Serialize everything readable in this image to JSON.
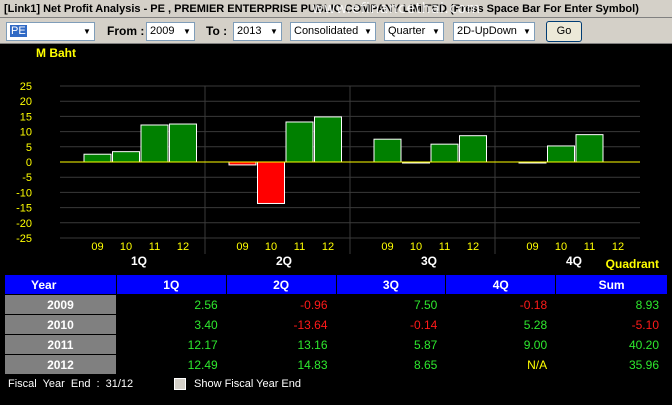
{
  "window": {
    "title": "[Link1] Net Profit Analysis - PE , PREMIER ENTERPRISE PUBLIC COMPANY LIMITED      (Press Space Bar For Enter Symbol)",
    "watermark": "www.efinancethai.com"
  },
  "toolbar": {
    "symbol_value": "PE",
    "from_label": "From :",
    "from_value": "2009",
    "to_label": "To :",
    "to_value": "2013",
    "statement_value": "Consolidated",
    "period_value": "Quarter",
    "view_value": "2D-UpDown",
    "go_label": "Go"
  },
  "chart_data": {
    "type": "bar",
    "ylabel": "M Baht",
    "xlabel": "Quadrant",
    "ylim": [
      -25,
      25
    ],
    "yticks": [
      25,
      20,
      15,
      10,
      5,
      0,
      -5,
      -10,
      -15,
      -20,
      -25
    ],
    "groups": [
      "1Q",
      "2Q",
      "3Q",
      "4Q"
    ],
    "years": [
      "09",
      "10",
      "11",
      "12"
    ],
    "values": [
      [
        2.56,
        3.4,
        12.17,
        12.49
      ],
      [
        -0.96,
        -13.64,
        13.16,
        14.83
      ],
      [
        7.5,
        -0.14,
        5.87,
        8.65
      ],
      [
        -0.18,
        5.28,
        9.0,
        null
      ]
    ],
    "colors": {
      "positive": "#008000",
      "negative": "#ff0000",
      "zero_line": "#ffff00",
      "tick_label": "#ffff00",
      "grid": "#3a3a3a"
    },
    "grid": true
  },
  "table": {
    "headers": [
      "Year",
      "1Q",
      "2Q",
      "3Q",
      "4Q",
      "Sum"
    ],
    "rows": [
      {
        "year": "2009",
        "q1": "2.56",
        "q2": "-0.96",
        "q3": "7.50",
        "q4": "-0.18",
        "sum": "8.93"
      },
      {
        "year": "2010",
        "q1": "3.40",
        "q2": "-13.64",
        "q3": "-0.14",
        "q4": "5.28",
        "sum": "-5.10"
      },
      {
        "year": "2011",
        "q1": "12.17",
        "q2": "13.16",
        "q3": "5.87",
        "q4": "9.00",
        "sum": "40.20"
      },
      {
        "year": "2012",
        "q1": "12.49",
        "q2": "14.83",
        "q3": "8.65",
        "q4": "N/A",
        "sum": "35.96"
      }
    ]
  },
  "footer": {
    "fiscal_label": "Fiscal Year End : 31/12",
    "show_fiscal_label": "Show Fiscal Year End",
    "show_fiscal_checked": false
  }
}
